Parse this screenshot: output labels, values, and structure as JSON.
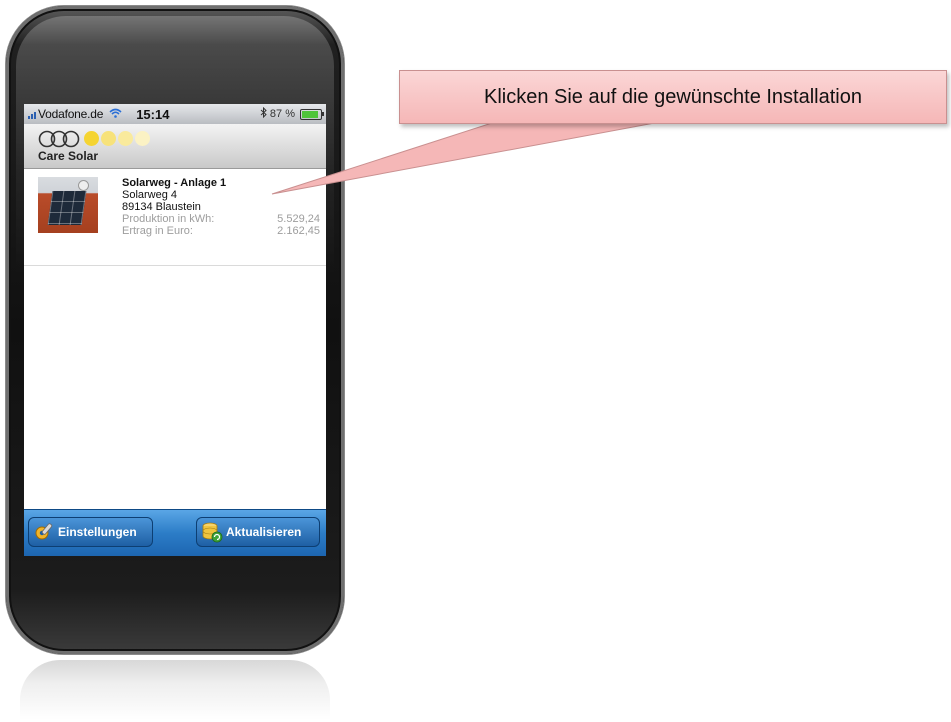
{
  "status": {
    "carrier": "Vodafone.de",
    "time": "15:14",
    "battery": "87 %",
    "battery_level": 0.87,
    "icons": [
      "signal-icon",
      "wifi-icon",
      "bluetooth-icon",
      "battery-icon"
    ]
  },
  "app": {
    "logo_text": "Care Solar",
    "sun_colors": [
      "#f5d431",
      "#f7e27a",
      "#f9ea9c",
      "#fbf2c4"
    ]
  },
  "installation": {
    "name": "Solarweg - Anlage 1",
    "street": "Solarweg 4",
    "city": "89134 Blaustein",
    "production_label": "Produktion in kWh:",
    "production_value": "5.529,24",
    "revenue_label": "Ertrag in Euro:",
    "revenue_value": "2.162,45"
  },
  "toolbar": {
    "settings_label": "Einstellungen",
    "refresh_label": "Aktualisieren",
    "settings_icon": "settings-icon",
    "refresh_icon": "database-refresh-icon"
  },
  "callout": {
    "text": "Klicken Sie auf die gewünschte Installation"
  },
  "colors": {
    "tabbar": "#2c7dc7",
    "callout_fill": "#f5b7b7"
  }
}
